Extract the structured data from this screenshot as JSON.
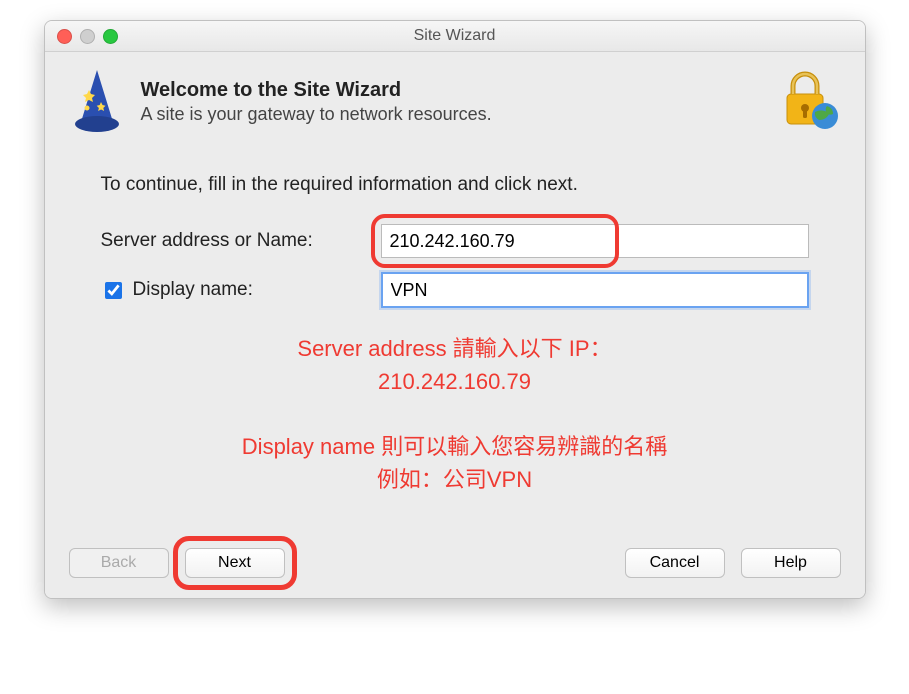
{
  "window": {
    "title": "Site Wizard"
  },
  "header": {
    "title": "Welcome to the Site Wizard",
    "subtitle": "A site is your gateway to network resources."
  },
  "instructions": "To continue, fill in the required information and click next.",
  "form": {
    "server_label": "Server address or Name:",
    "server_value": "210.242.160.79",
    "display_label": "Display name:",
    "display_checked": true,
    "display_value": "VPN"
  },
  "annotations": {
    "line1": "Server address 請輸入以下 IP：",
    "line2": "210.242.160.79",
    "line3": "Display name 則可以輸入您容易辨識的名稱",
    "line4": "例如：公司VPN"
  },
  "buttons": {
    "back": "Back",
    "next": "Next",
    "cancel": "Cancel",
    "help": "Help"
  },
  "colors": {
    "highlight": "#ef3a32"
  }
}
